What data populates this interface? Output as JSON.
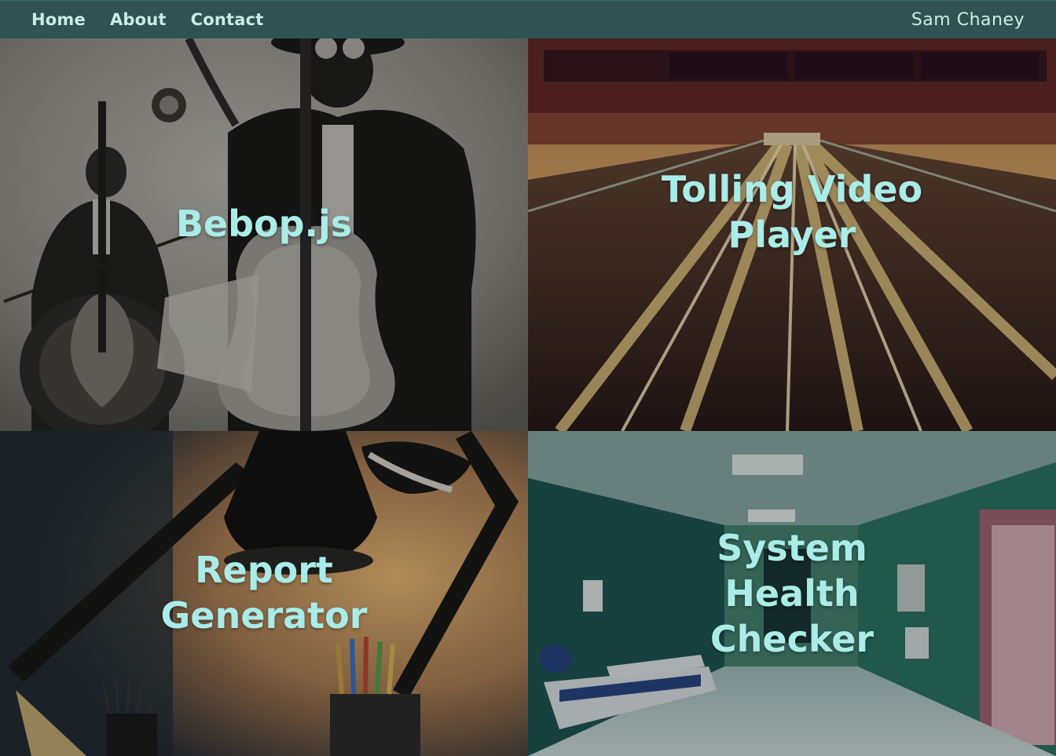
{
  "nav": {
    "links": [
      {
        "label": "Home"
      },
      {
        "label": "About"
      },
      {
        "label": "Contact"
      }
    ],
    "brand": "Sam Chaney"
  },
  "projects": [
    {
      "title": "Bebop.js",
      "image": "jazz-musicians-illustration"
    },
    {
      "title": "Tolling Video\nPlayer",
      "image": "highway-toll-light-trails"
    },
    {
      "title": "Report\nGenerator",
      "image": "desk-lamp-pencils"
    },
    {
      "title": "System\nHealth\nChecker",
      "image": "hospital-corridor"
    }
  ],
  "colors": {
    "navbar": "#2e5352",
    "nav_text": "#c7ecea",
    "title_text": "#a9ece8"
  }
}
